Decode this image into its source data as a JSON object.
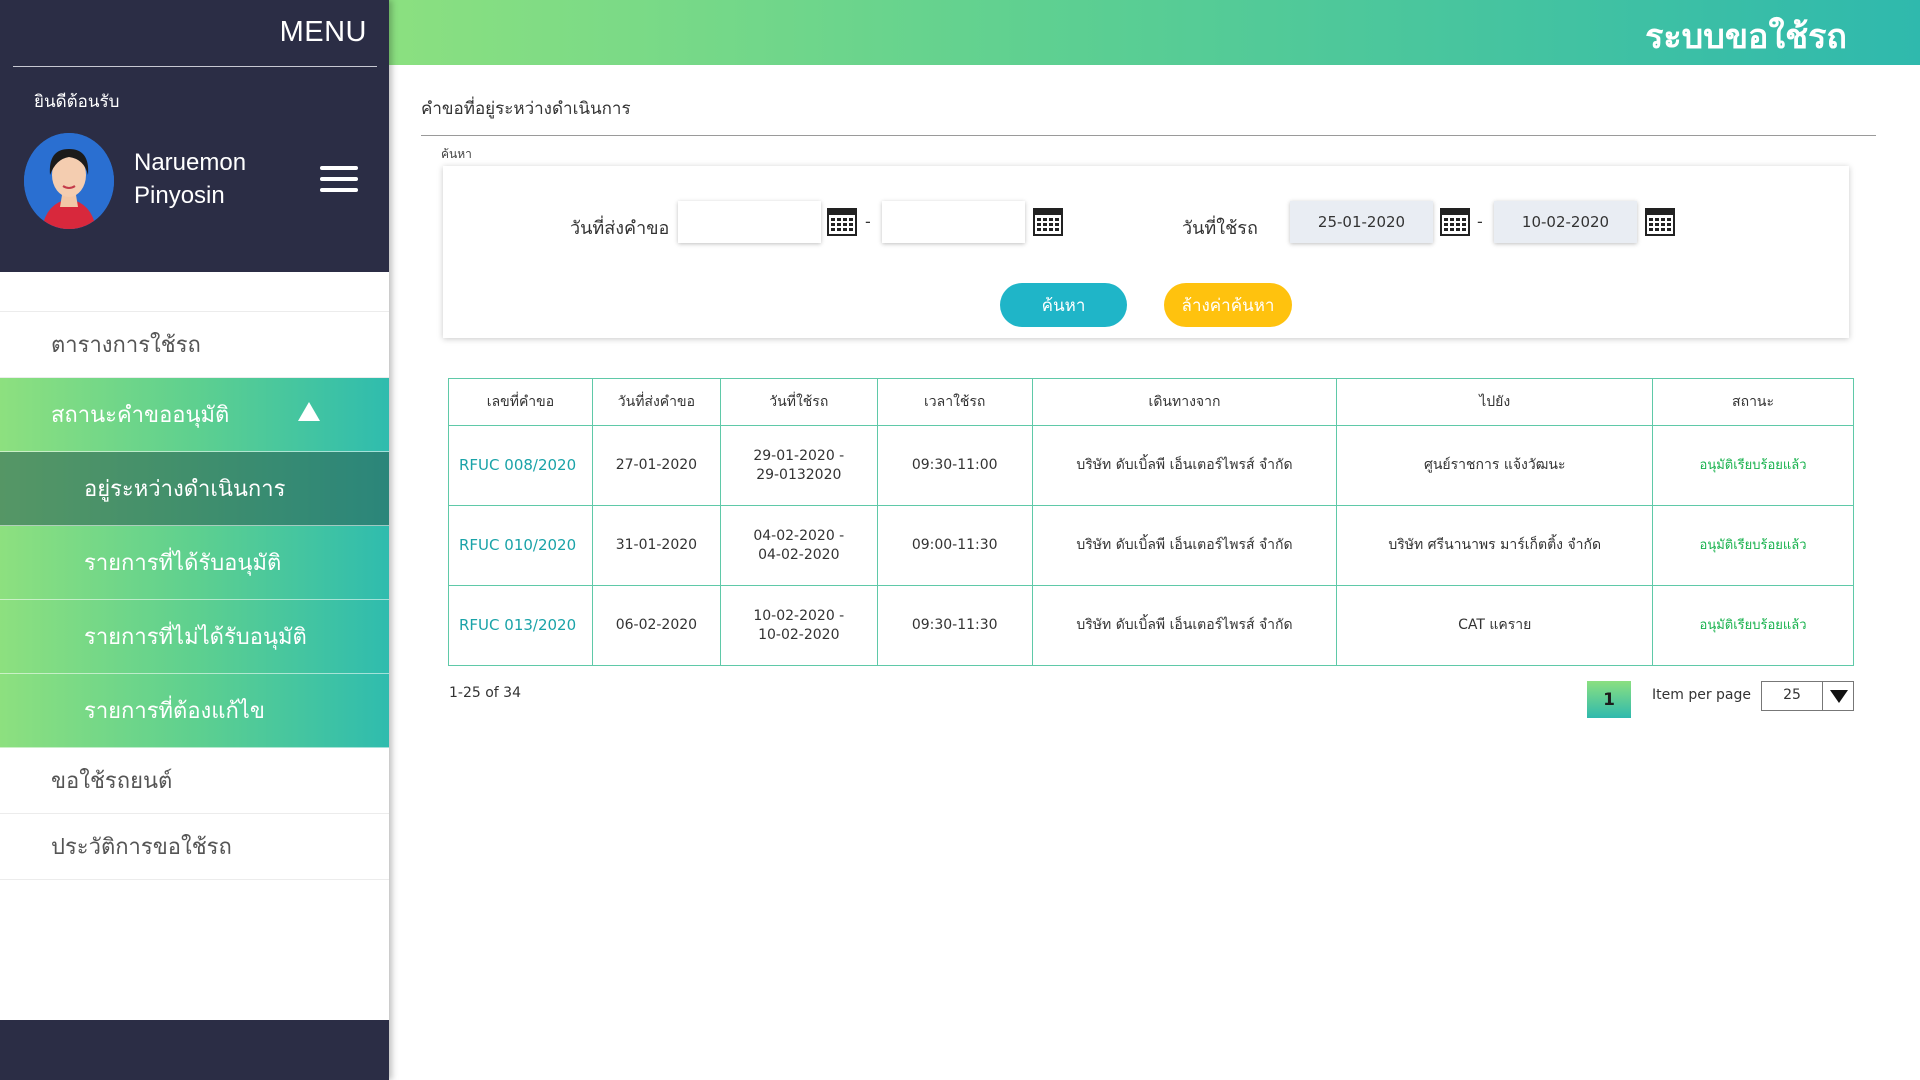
{
  "sidebar": {
    "menu_title": "MENU",
    "welcome": "ยินดีต้อนรับ",
    "user_first": "Naruemon",
    "user_last": "Pinyosin",
    "items": [
      {
        "label": "ตารางการใช้รถ"
      },
      {
        "label": "สถานะคำขออนุมัติ"
      },
      {
        "label": "อยู่ระหว่างดำเนินการ"
      },
      {
        "label": "รายการที่ได้รับอนุมัติ"
      },
      {
        "label": "รายการที่ไม่ได้รับอนุมัติ"
      },
      {
        "label": "รายการที่ต้องแก้ไข"
      },
      {
        "label": "ขอใช้รถยนต์"
      },
      {
        "label": "ประวัติการขอใช้รถ"
      }
    ]
  },
  "header": {
    "title": "ระบบขอใช้รถ"
  },
  "main": {
    "page_title": "คำขอที่อยู่ระหว่างดำเนินการ",
    "search_label": "ค้นหา",
    "request_date_label": "วันที่ส่งคำขอ",
    "request_date_from": "",
    "request_date_to": "",
    "use_date_label": "วันที่ใช้รถ",
    "use_date_from": "25-01-2020",
    "use_date_to": "10-02-2020",
    "dash": "-",
    "search_button": "ค้นหา",
    "clear_button": "ล้างค่าค้นหา"
  },
  "table": {
    "headers": [
      "เลขที่คำขอ",
      "วันที่ส่งคำขอ",
      "วันที่ใช้รถ",
      "เวลาใช้รถ",
      "เดินทางจาก",
      "ไปยัง",
      "สถานะ"
    ],
    "rows": [
      {
        "req_no": "RFUC 008/2020",
        "submit_date": "27-01-2020",
        "use_date_1": "29-01-2020 -",
        "use_date_2": "29-0132020",
        "time": "09:30-11:00",
        "from": "บริษัท ดับเบิ้ลพี เอ็นเตอร์ไพรส์ จำกัด",
        "to": "ศูนย์ราชการ แจ้งวัฒนะ",
        "status": "อนุมัติเรียบร้อยแล้ว"
      },
      {
        "req_no": "RFUC 010/2020",
        "submit_date": "31-01-2020",
        "use_date_1": "04-02-2020 -",
        "use_date_2": "04-02-2020",
        "time": "09:00-11:30",
        "from": "บริษัท ดับเบิ้ลพี เอ็นเตอร์ไพรส์ จำกัด",
        "to": "บริษัท ศรีนานาพร มาร์เก็ตติ้ง จำกัด",
        "status": "อนุมัติเรียบร้อยแล้ว"
      },
      {
        "req_no": "RFUC 013/2020",
        "submit_date": "06-02-2020",
        "use_date_1": "10-02-2020 -",
        "use_date_2": "10-02-2020",
        "time": "09:30-11:30",
        "from": "บริษัท ดับเบิ้ลพี เอ็นเตอร์ไพรส์ จำกัด",
        "to": "CAT แคราย",
        "status": "อนุมัติเรียบร้อยแล้ว"
      }
    ]
  },
  "pagination": {
    "range_text": "1-25 of 34",
    "current_page": "1",
    "items_per_page_label": "Item per page",
    "items_per_page": "25"
  },
  "colors": {
    "sidebar_dark": "#2b2d45",
    "accent_green": "#8be080",
    "accent_teal": "#2fb9ad",
    "search_button": "#1fb5c8",
    "clear_button": "#ffc20e",
    "link": "#1aa3a8",
    "status_green": "#19b24e"
  },
  "icons": {
    "calendar": "calendar-icon",
    "menu": "hamburger-icon",
    "collapse": "caret-up-icon",
    "dropdown": "caret-down-icon"
  }
}
